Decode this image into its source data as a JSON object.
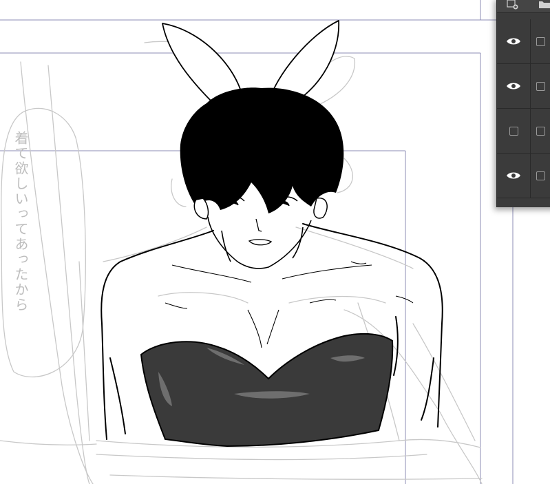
{
  "canvas": {
    "note_text": "着て欲しいってあったから"
  },
  "layer_panel": {
    "toolbar": {
      "new_layer_icon": "new-layer-icon",
      "new_folder_icon": "new-folder-icon"
    },
    "layers": [
      {
        "visible": true
      },
      {
        "visible": true
      },
      {
        "visible": false
      },
      {
        "visible": true
      }
    ]
  },
  "colors": {
    "panel_bg": "#3b3b3b",
    "panel_border": "#2a2a2a",
    "guide_lines": "#8c8cb4",
    "sketch_lines": "#c8c8c8",
    "ink": "#000000",
    "fill_gray": "#3a3a3a"
  }
}
